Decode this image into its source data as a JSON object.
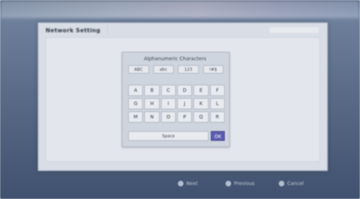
{
  "dialog": {
    "title": "Network Setting"
  },
  "keyboard": {
    "title": "Alphanumeric Characters",
    "tabs": [
      "ABC",
      "abc",
      "123",
      "!#$"
    ],
    "keys": [
      "A",
      "B",
      "C",
      "D",
      "E",
      "F",
      "G",
      "H",
      "I",
      "J",
      "K",
      "L",
      "M",
      "N",
      "O",
      "P",
      "Q",
      "R"
    ],
    "space_label": "Space",
    "ok_label": "OK"
  },
  "footer": {
    "buttons": [
      "Next",
      "Previous",
      "Cancel"
    ]
  }
}
